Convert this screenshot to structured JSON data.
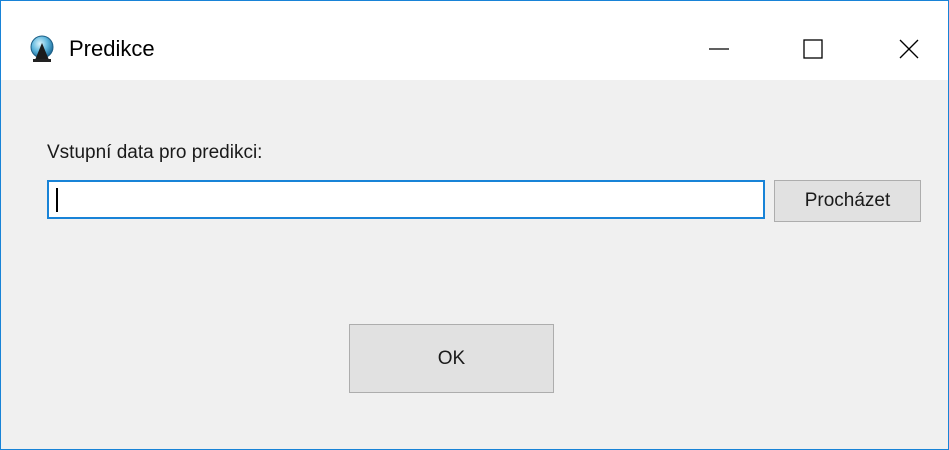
{
  "window": {
    "title": "Predikce",
    "accent_color": "#1883d7",
    "icons": {
      "app": "app-globe-icon",
      "minimize": "minimize-icon",
      "maximize": "maximize-icon",
      "close": "close-icon"
    }
  },
  "form": {
    "label": "Vstupní data pro predikci:",
    "input_value": "",
    "input_placeholder": "",
    "browse_label": "Procházet",
    "ok_label": "OK"
  }
}
